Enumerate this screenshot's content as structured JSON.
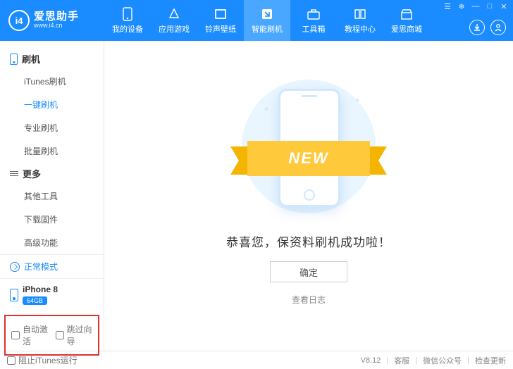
{
  "logo": {
    "abbr": "i4",
    "cn": "爱思助手",
    "url": "www.i4.cn"
  },
  "nav": [
    {
      "label": "我的设备"
    },
    {
      "label": "应用游戏"
    },
    {
      "label": "铃声壁纸"
    },
    {
      "label": "智能刷机"
    },
    {
      "label": "工具箱"
    },
    {
      "label": "教程中心"
    },
    {
      "label": "爱思商城"
    }
  ],
  "sidebar": {
    "section1": {
      "title": "刷机",
      "items": [
        "iTunes刷机",
        "一键刷机",
        "专业刷机",
        "批量刷机"
      ]
    },
    "section2": {
      "title": "更多",
      "items": [
        "其他工具",
        "下载固件",
        "高级功能"
      ]
    },
    "mode": "正常模式",
    "device": {
      "name": "iPhone 8",
      "storage": "64GB"
    },
    "checks": {
      "auto_activate": "自动激活",
      "skip_guide": "跳过向导"
    }
  },
  "content": {
    "ribbon": "NEW",
    "success": "恭喜您，保资料刷机成功啦！",
    "ok": "确定",
    "log": "查看日志"
  },
  "footer": {
    "block_itunes": "阻止iTunes运行",
    "version": "V8.12",
    "support": "客服",
    "wechat": "微信公众号",
    "update": "检查更新"
  }
}
